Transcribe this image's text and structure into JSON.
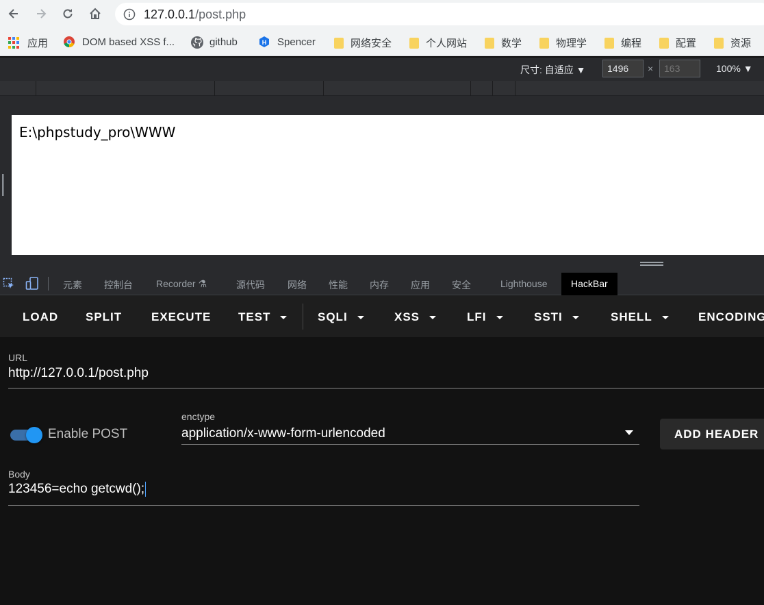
{
  "browser": {
    "url_host": "127.0.0.1",
    "url_path": "/post.php"
  },
  "bookmarks": [
    {
      "label": "应用",
      "icon": "apps-icon"
    },
    {
      "label": "DOM based XSS f...",
      "icon": "chrome-icon"
    },
    {
      "label": "github",
      "icon": "github-icon"
    },
    {
      "label": "Spencer",
      "icon": "hexagon-icon"
    },
    {
      "label": "网络安全",
      "icon": "folder-icon"
    },
    {
      "label": "个人网站",
      "icon": "folder-icon"
    },
    {
      "label": "数学",
      "icon": "folder-icon"
    },
    {
      "label": "物理学",
      "icon": "folder-icon"
    },
    {
      "label": "编程",
      "icon": "folder-icon"
    },
    {
      "label": "配置",
      "icon": "folder-icon"
    },
    {
      "label": "资源",
      "icon": "folder-icon"
    }
  ],
  "device_toolbar": {
    "size_label": "尺寸: 自适应 ▼",
    "width": "1496",
    "times": "×",
    "height_placeholder": "163",
    "zoom": "100% ▼"
  },
  "page": {
    "output": "E:\\phpstudy_pro\\WWW"
  },
  "devtools_tabs": [
    {
      "label": "元素"
    },
    {
      "label": "控制台"
    },
    {
      "label": "Recorder"
    },
    {
      "label": "源代码"
    },
    {
      "label": "网络"
    },
    {
      "label": "性能"
    },
    {
      "label": "内存"
    },
    {
      "label": "应用"
    },
    {
      "label": "安全"
    },
    {
      "label": "Lighthouse"
    },
    {
      "label": "HackBar"
    }
  ],
  "hackbar": {
    "buttons": [
      {
        "label": "LOAD"
      },
      {
        "label": "SPLIT"
      },
      {
        "label": "EXECUTE"
      },
      {
        "label": "TEST"
      },
      {
        "label": "SQLI"
      },
      {
        "label": "XSS"
      },
      {
        "label": "LFI"
      },
      {
        "label": "SSTI"
      },
      {
        "label": "SHELL"
      },
      {
        "label": "ENCODING"
      }
    ],
    "url_label": "URL",
    "url_value": "http://127.0.0.1/post.php",
    "enable_post_label": "Enable POST",
    "enable_post": true,
    "enctype_label": "enctype",
    "enctype_value": "application/x-www-form-urlencoded",
    "add_header_label": "ADD HEADER",
    "body_label": "Body",
    "body_value": "123456=echo getcwd();"
  },
  "colors": {
    "accent": "#2196f3",
    "panel_bg": "#121212",
    "toolbar_bg": "#1e1e1e"
  }
}
